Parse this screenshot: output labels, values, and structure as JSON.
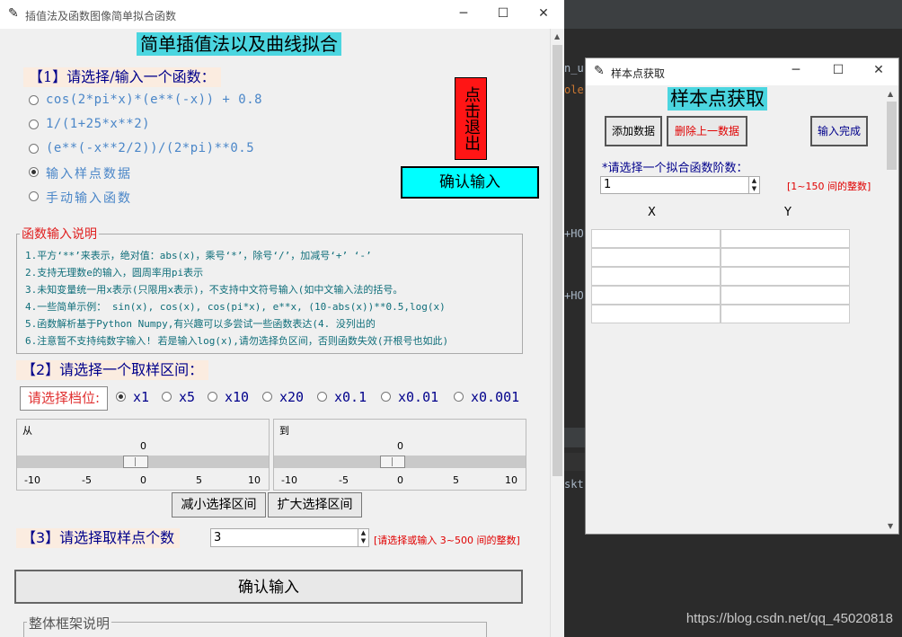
{
  "main_window": {
    "title": "插值法及函数图像简单拟合函数",
    "heading": "简单插值法以及曲线拟合",
    "section1_label": "【1】请选择/输入一个函数：",
    "function_options": [
      "cos(2*pi*x)*(e**(-x)) + 0.8",
      "1/(1+25*x**2)",
      "(e**(-x**2/2))/(2*pi)**0.5",
      "输入样点数据",
      "手动输入函数"
    ],
    "selected_option_index": 3,
    "exit_button": "点击退出",
    "confirm_top_button": "确认输入",
    "help_title": "函数输入说明",
    "help_lines": [
      "1.平方‘**’来表示，绝对值：abs(x)，乘号‘*’，除号‘/’，加减号‘+’ ‘-’",
      "2.支持无理数e的输入，圆周率用pi表示",
      "3.未知变量统一用x表示(只限用x表示)，不支持中文符号输入(如中文输入法的括号。",
      "4.一些简单示例： sin(x), cos(x), cos(pi*x), e**x, (10-abs(x))**0.5,log(x)",
      "5.函数解析基于Python Numpy,有兴趣可以多尝试一些函数表达(4. 没列出的",
      "6.注意暂不支持纯数字输入! 若是输入log(x),请勿选择负区间，否则函数失效(开根号也如此)"
    ],
    "section2_label": "【2】请选择一个取样区间：",
    "gear_label": "请选择档位:",
    "gear_options": [
      "x1",
      "x5",
      "x10",
      "x20",
      "x0.1",
      "x0.01",
      "x0.001"
    ],
    "gear_selected_index": 0,
    "slider_from": {
      "label": "从",
      "value": "0",
      "ticks": [
        "-10",
        "-5",
        "0",
        "5",
        "10"
      ],
      "min": -10,
      "max": 10,
      "current": 0
    },
    "slider_to": {
      "label": "到",
      "value": "0",
      "ticks": [
        "-10",
        "-5",
        "0",
        "5",
        "10"
      ],
      "min": -10,
      "max": 10,
      "current": 0
    },
    "shrink_button": "减小选择区间",
    "expand_button": "扩大选择区间",
    "section3_label": "【3】请选择取样点个数",
    "sample_count_value": "3",
    "sample_count_hint": "[请选择或输入 3~500 间的整数]",
    "confirm_bottom_button": "确认输入",
    "frame_title": "整体框架说明"
  },
  "sample_window": {
    "title": "样本点获取",
    "heading": "样本点获取",
    "add_button": "添加数据",
    "delete_button": "删除上一数据",
    "done_button": "输入完成",
    "degree_label": "*请选择一个拟合函数阶数：",
    "degree_value": "1",
    "degree_hint": "[1~150 间的整数]",
    "col_x": "X",
    "col_y": "Y"
  },
  "window_controls": {
    "minimize": "─",
    "maximize": "☐",
    "close": "✕"
  },
  "editor_fragments": [
    "n_u",
    "ole",
    "+HO",
    "+HO",
    "skt"
  ],
  "watermark": "https://blog.csdn.net/qq_45020818",
  "colors": {
    "heading_bg": "#4bd6e0",
    "exit_bg": "#ff1515",
    "confirm_bg": "#00ffff",
    "option_text": "#4a86c8",
    "section_text": "#00008b",
    "help_text": "#0f6e7a",
    "hint_red": "#e00000"
  }
}
